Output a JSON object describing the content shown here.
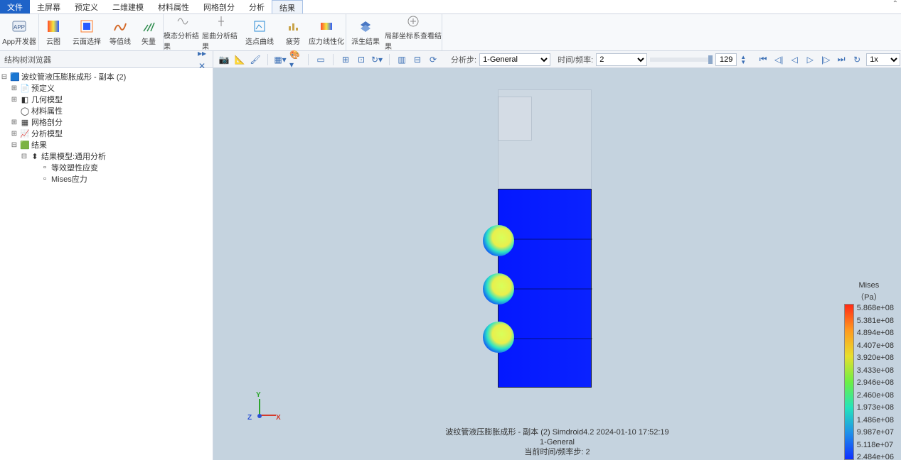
{
  "menu": {
    "items": [
      "文件",
      "主屏幕",
      "预定义",
      "二维建模",
      "材料属性",
      "网格剖分",
      "分析",
      "结果"
    ],
    "active_index": 0,
    "selected_index": 7
  },
  "ribbon": {
    "groups": [
      {
        "buttons": [
          {
            "label": "App开发器"
          }
        ]
      },
      {
        "buttons": [
          {
            "label": "云图"
          },
          {
            "label": "云面选择"
          },
          {
            "label": "等值线"
          },
          {
            "label": "矢量"
          }
        ]
      },
      {
        "buttons": [
          {
            "label": "模态分析结果"
          },
          {
            "label": "屈曲分析结果"
          },
          {
            "label": "选点曲线"
          },
          {
            "label": "疲劳"
          },
          {
            "label": "应力线性化"
          }
        ]
      },
      {
        "buttons": [
          {
            "label": "派生结果"
          },
          {
            "label": "局部坐标系查看结果"
          }
        ]
      }
    ]
  },
  "toolbar": {
    "panel_title": "结构树浏览器",
    "analysis_step_label": "分析步:",
    "analysis_step_value": "1-General",
    "time_freq_label": "时间/频率:",
    "time_freq_value": "2",
    "frame_value": "129",
    "speed_value": "1x"
  },
  "tree": {
    "root": "波纹管液压膨胀成形 - 副本 (2)",
    "items": [
      {
        "indent": 1,
        "toggle": "+",
        "label": "预定义"
      },
      {
        "indent": 1,
        "toggle": "+",
        "label": "几何模型"
      },
      {
        "indent": 1,
        "toggle": "",
        "label": "材料属性"
      },
      {
        "indent": 1,
        "toggle": "+",
        "label": "网格剖分"
      },
      {
        "indent": 1,
        "toggle": "+",
        "label": "分析模型"
      },
      {
        "indent": 1,
        "toggle": "-",
        "label": "结果"
      },
      {
        "indent": 2,
        "toggle": "-",
        "label": "结果模型:通用分析"
      },
      {
        "indent": 3,
        "toggle": "",
        "label": "等效塑性应变"
      },
      {
        "indent": 3,
        "toggle": "",
        "label": "Mises应力"
      }
    ]
  },
  "caption": {
    "line1": "波纹管液压膨胀成形 - 副本 (2)  Simdroid4.2  2024-01-10 17:52:19",
    "line2": "1-General",
    "line3": "当前时间/频率步:  2"
  },
  "legend": {
    "title1": "Mises",
    "title2": "（Pa）",
    "values": [
      "5.868e+08",
      "5.381e+08",
      "4.894e+08",
      "4.407e+08",
      "3.920e+08",
      "3.433e+08",
      "2.946e+08",
      "2.460e+08",
      "1.973e+08",
      "1.486e+08",
      "9.987e+07",
      "5.118e+07",
      "2.484e+06"
    ]
  },
  "axis": {
    "x": "X",
    "y": "Y",
    "z": "Z"
  }
}
